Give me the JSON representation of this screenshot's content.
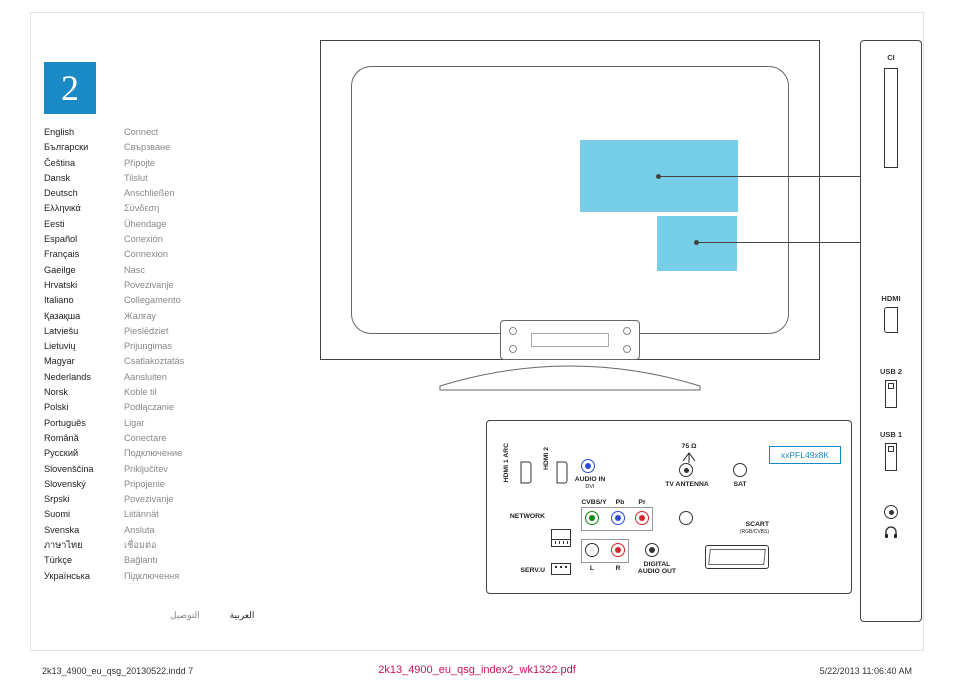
{
  "step_number": "2",
  "languages": [
    {
      "lang": "English",
      "word": "Connect"
    },
    {
      "lang": "Български",
      "word": "Свързване"
    },
    {
      "lang": "Čeština",
      "word": "Připojte"
    },
    {
      "lang": "Dansk",
      "word": "Tilslut"
    },
    {
      "lang": "Deutsch",
      "word": "Anschließen"
    },
    {
      "lang": "Ελληνικά",
      "word": "Σύνδεση"
    },
    {
      "lang": "Eesti",
      "word": "Ühendage"
    },
    {
      "lang": "Español",
      "word": "Conexión"
    },
    {
      "lang": "Français",
      "word": "Connexion"
    },
    {
      "lang": "Gaeilge",
      "word": "Nasc"
    },
    {
      "lang": "Hrvatski",
      "word": "Povezivanje"
    },
    {
      "lang": "Italiano",
      "word": "Collegamento"
    },
    {
      "lang": "Қазақша",
      "word": "Жалғау"
    },
    {
      "lang": "Latviešu",
      "word": "Pieslēdziet"
    },
    {
      "lang": "Lietuvių",
      "word": "Prijungimas"
    },
    {
      "lang": "Magyar",
      "word": "Csatlakoztatás"
    },
    {
      "lang": "Nederlands",
      "word": "Aansluiten"
    },
    {
      "lang": "Norsk",
      "word": "Koble til"
    },
    {
      "lang": "Polski",
      "word": "Podłączanie"
    },
    {
      "lang": "Português",
      "word": "Ligar"
    },
    {
      "lang": "Română",
      "word": "Conectare"
    },
    {
      "lang": "Русский",
      "word": "Подключение"
    },
    {
      "lang": "Slovenščina",
      "word": "Priključitev"
    },
    {
      "lang": "Slovenský",
      "word": "Pripojenie"
    },
    {
      "lang": "Srpski",
      "word": "Povezivanje"
    },
    {
      "lang": "Suomi",
      "word": "Liitännät"
    },
    {
      "lang": "Svenska",
      "word": "Ansluta"
    },
    {
      "lang": "ภาษาไทย",
      "word": "เชื่อมต่อ"
    },
    {
      "lang": "Türkçe",
      "word": "Bağlantı"
    },
    {
      "lang": "Українська",
      "word": "Підключення"
    }
  ],
  "arabic": {
    "lang": "العربية",
    "word": "التوصيل"
  },
  "connectors": {
    "hdmi1": "HDMI 1 ARC",
    "hdmi2": "HDMI 2",
    "audio_in": "AUDIO IN",
    "audio_in_sub": "DVI",
    "antenna_ohm": "75 Ω",
    "tv_antenna": "TV ANTENNA",
    "sat": "SAT",
    "model": "xxPFL49x8K",
    "network": "NETWORK",
    "cvbs": "CVBS/Y",
    "pb": "Pb",
    "pr": "Pr",
    "scart": "SCART",
    "scart_sub": "(RGB/CVBS)",
    "servu": "SERV.U",
    "l": "L",
    "r": "R",
    "digital_audio": "DIGITAL AUDIO OUT"
  },
  "side": {
    "ci": "CI",
    "hdmi": "HDMI",
    "usb2": "USB 2",
    "usb1": "USB 1"
  },
  "footer": {
    "left": "2k13_4900_eu_qsg_20130522.indd   7",
    "center": "2k13_4900_eu_qsg_index2_wk1322.pdf",
    "right": "5/22/2013   11:06:40 AM"
  }
}
